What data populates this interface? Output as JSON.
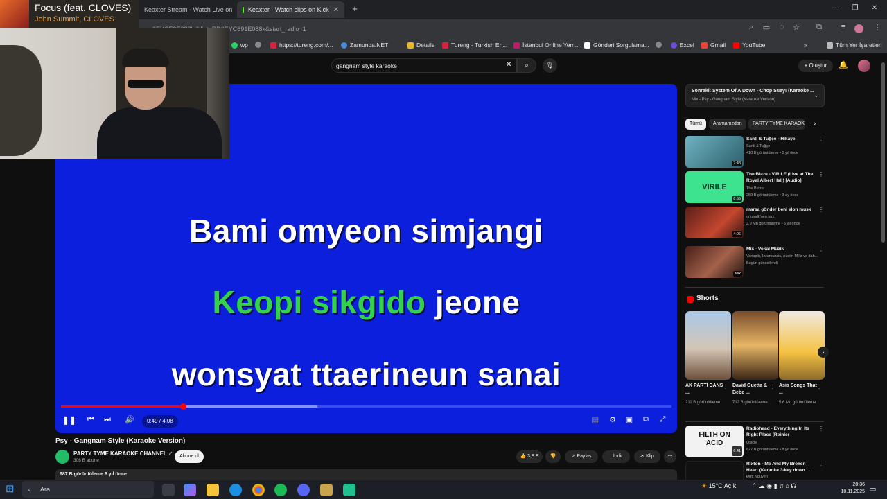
{
  "browser": {
    "tabs": [
      {
        "label": "Keaxter Stream - Watch Live on",
        "active": false
      },
      {
        "label": "Keaxter - Watch clips on Kick",
        "active": true
      }
    ],
    "url": "0EYCE9E088kdklist=RD0EYC691E088k&start_radio=1",
    "bookmarks": [
      "wp",
      "https://tureng.com/...",
      "Zamunda.NET",
      "Detaile",
      "Tureng - Turkish En...",
      "İstanbul Online Yem...",
      "Gönderi Sorgulama...",
      "Excel",
      "Gmail",
      "YouTube"
    ],
    "bookmarks_folder": "Tüm Yer İşaretleri"
  },
  "now_playing": {
    "title": "Focus (feat. CLOVES)",
    "artist": "John Summit, CLOVES"
  },
  "youtube": {
    "search_value": "gangnam style karaoke",
    "create_label": "Oluştur"
  },
  "player": {
    "lyrics": {
      "line1": "Bami omyeon simjangi",
      "line2_sung": "Keopi sikgido",
      "line2_rest": " jeone",
      "line3": "wonsyat ttaerineun sanai"
    },
    "time": "0:49 / 4:08",
    "progress": 0.2,
    "buffered": 0.42,
    "colors": {
      "background": "#0c1fdc",
      "sung": "#34d14c"
    }
  },
  "video": {
    "title": "Psy - Gangnam Style (Karaoke Version)",
    "channel": "PARTY TYME KARAOKE CHANNEL",
    "subscribers": "306 B abone",
    "subscribe_label": "Abone ol",
    "likes": "3,8 B",
    "share_label": "Paylaş",
    "download_label": "İndir",
    "clip_label": "Klip",
    "views_date": "687 B görüntüleme  6 yıl önce"
  },
  "sidebar": {
    "next_title": "Sonraki: System Of A Down - Chop Suey! (Karaoke ...",
    "next_sub": "Mix - Psy - Gangnam Style (Karaoke Version)",
    "chips": [
      "Tümü",
      "Aramanızdan",
      "PARTY TYME KARAOKE"
    ],
    "related": [
      {
        "title": "Santi & Tuğçe - Hikaye",
        "channel": "Santi & Tuğçe",
        "meta": "410 B görüntüleme • 5 yıl önce",
        "duration": "7:48"
      },
      {
        "title": "The Blaze - VIRILE (Live at The Royal Albert Hall) [Audio]",
        "channel": "The Blaze",
        "meta": "259 B görüntüleme • 3 ay önce",
        "duration": "6:56",
        "thumb_text": "VIRILE"
      },
      {
        "title": "marsa gönder beni elon musk",
        "channel": "orkundk'nen tarzı",
        "meta": "2,9 Mn görüntüleme • 5 yıl önce",
        "duration": "4:06"
      },
      {
        "title": "Mix - Vokal Müzik",
        "channel": "Vanapiü, Izzamuzzic, Austin Millz ve dah...",
        "meta": "Bugün güncellendi",
        "duration": "Mix"
      }
    ],
    "shorts_label": "Shorts",
    "shorts": [
      {
        "title": "AK PARTİ DANS ...",
        "views": "211 B görüntüleme"
      },
      {
        "title": "David Guetta & Bebe ...",
        "views": "712 B görüntüleme"
      },
      {
        "title": "Asia Songs That ...",
        "views": "5,6 Mn görüntüleme"
      }
    ],
    "related2": [
      {
        "title": "Radiohead - Everything In Its Right Place (Reinier Zonneveld...",
        "channel": "Osicle",
        "meta": "627 B görüntüleme • 8 yıl önce",
        "duration": "6:41",
        "thumb_text": "FILTH ON ACID"
      },
      {
        "title": "Rixton - Me And My Broken Heart (Karaoke 3-key down ...",
        "channel": "Đức Nguyễn",
        "meta": ""
      }
    ]
  },
  "taskbar": {
    "search_label": "Ara",
    "weather": "15°C  Açık",
    "time": "20:36",
    "date": "18.11.2025"
  }
}
